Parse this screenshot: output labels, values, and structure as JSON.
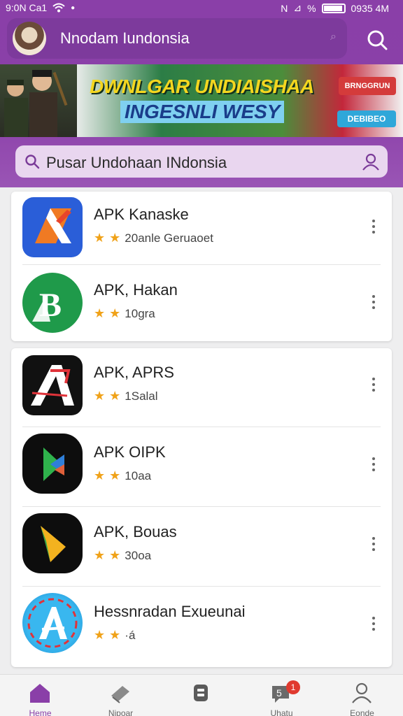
{
  "status_bar": {
    "left": "9:0N Ca1",
    "right_percent": "%",
    "time": "0935 4M"
  },
  "header": {
    "title": "Nnodam Iundonsia"
  },
  "banner": {
    "line1": "DWNLGAR UNDIAISHAA",
    "line2": "INGESNLI WESY",
    "badge": "BRNGGRUN",
    "button": "DEBIBEO"
  },
  "search": {
    "placeholder": "Pusar Undohaan INdonsia"
  },
  "apps": [
    {
      "name": "APK Kanaske",
      "meta": "20anle Geruaoet",
      "icon": "orange-blue-app-icon"
    },
    {
      "name": "APK, Hakan",
      "meta": "10gra",
      "icon": "green-b-app-icon"
    },
    {
      "name": "APK, APRS",
      "meta": "1Salal",
      "icon": "black-a-app-icon"
    },
    {
      "name": "APK OIPK",
      "meta": "10aa",
      "icon": "black-green-app-icon"
    },
    {
      "name": "APK, Bouas",
      "meta": "30oa",
      "icon": "black-yellow-app-icon"
    },
    {
      "name": "Hessnradan Exueunai",
      "meta": "·á",
      "icon": "blue-a-app-icon"
    }
  ],
  "nav": [
    {
      "label": "Heme",
      "icon": "home-icon",
      "active": true
    },
    {
      "label": "Nipoar",
      "icon": "book-icon"
    },
    {
      "label": "",
      "icon": "square-icon"
    },
    {
      "label": "Uhatu",
      "icon": "chat-icon",
      "badge": "1"
    },
    {
      "label": "Eonde",
      "icon": "profile-icon"
    }
  ],
  "colors": {
    "primary": "#8a3fa8",
    "star": "#f0a219",
    "badge": "#e03a2f"
  }
}
